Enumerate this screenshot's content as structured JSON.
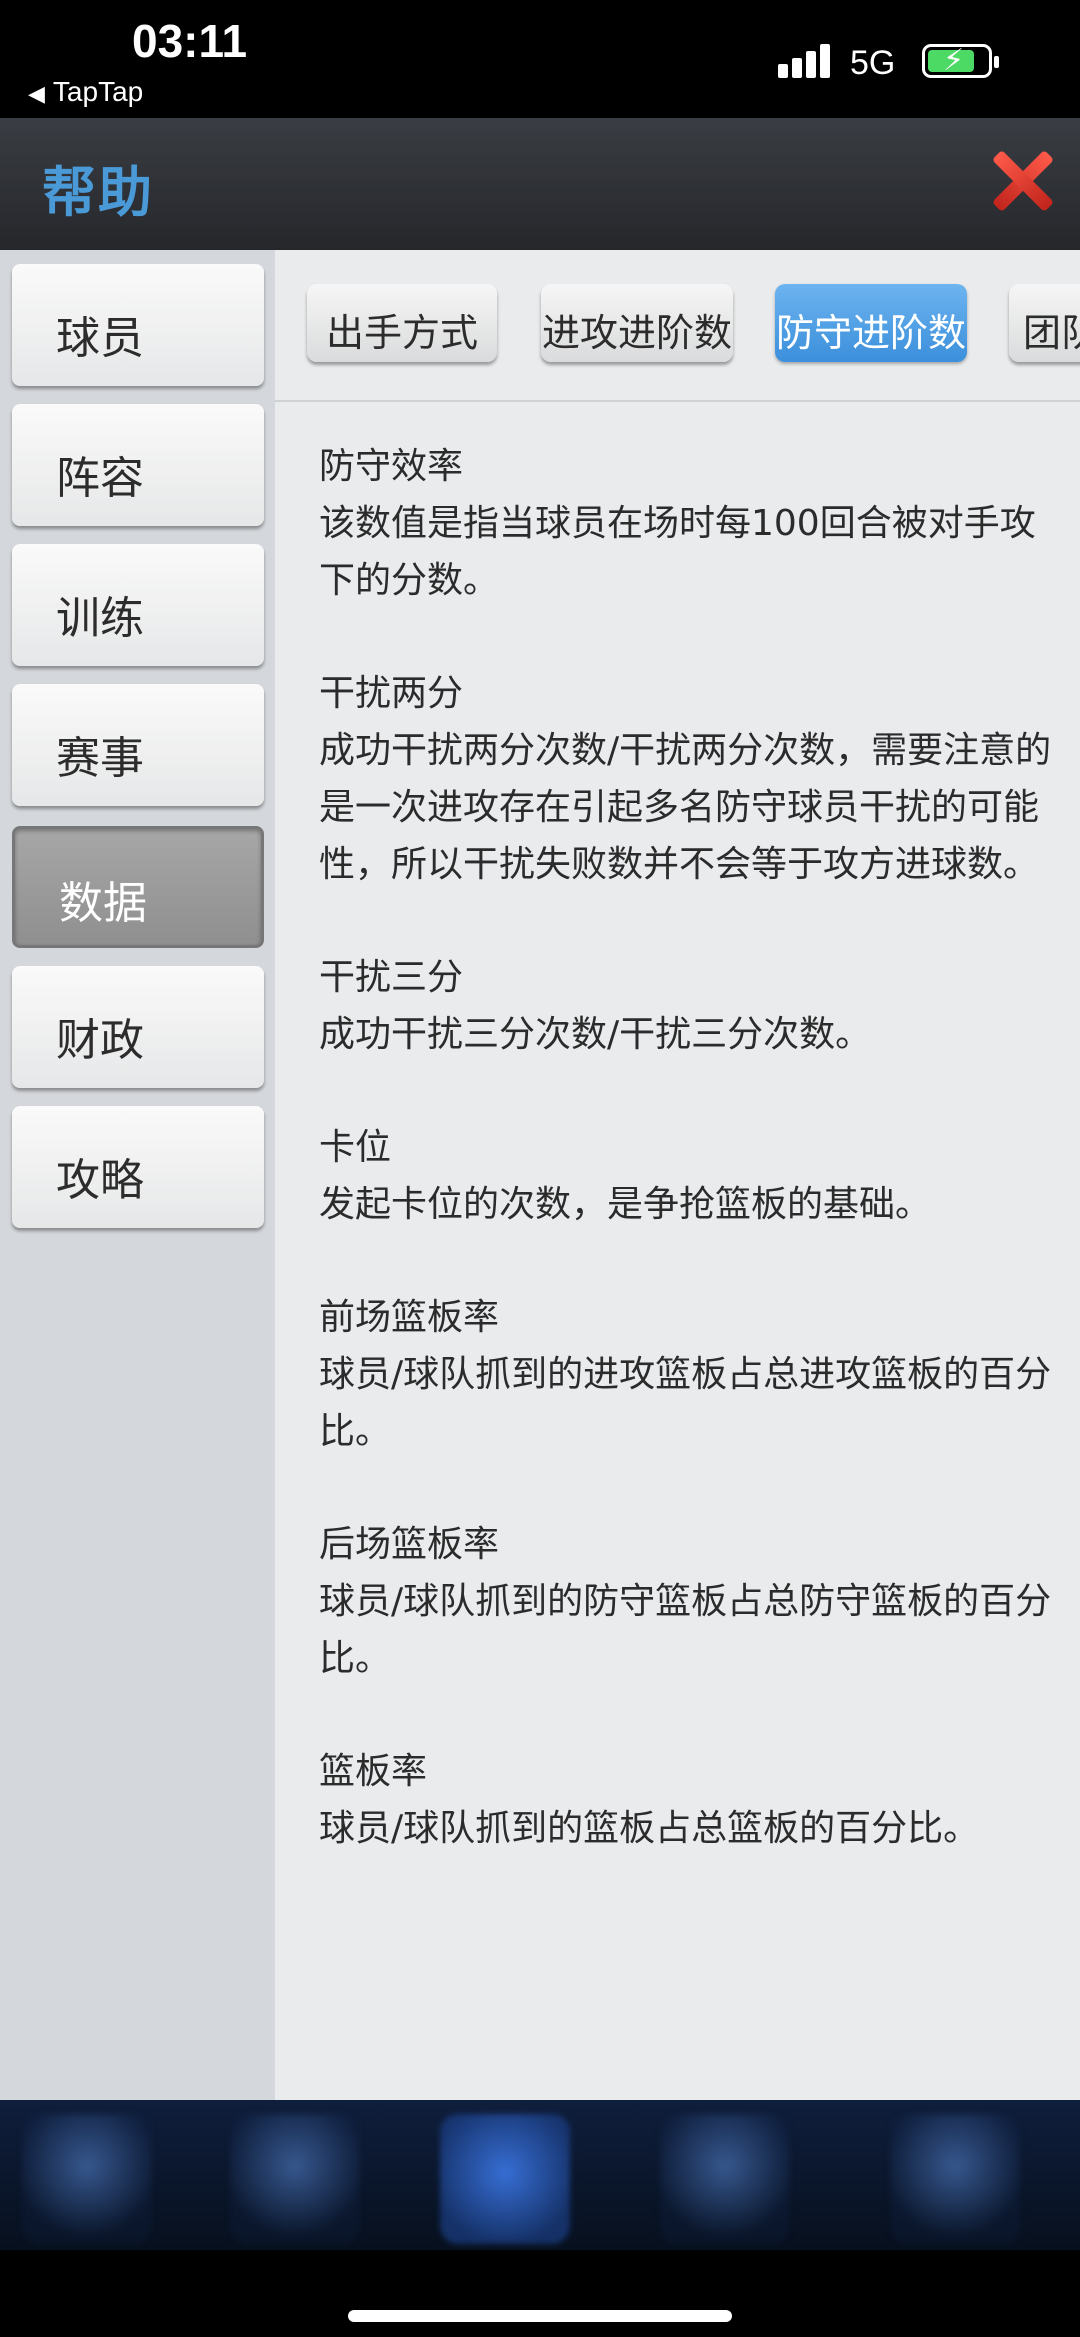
{
  "status_bar": {
    "time": "03:11",
    "back_app": "TapTap",
    "network": "5G"
  },
  "header": {
    "title": "帮助"
  },
  "sidebar": {
    "items": [
      {
        "label": "球员",
        "active": false
      },
      {
        "label": "阵容",
        "active": false
      },
      {
        "label": "训练",
        "active": false
      },
      {
        "label": "赛事",
        "active": false
      },
      {
        "label": "数据",
        "active": true
      },
      {
        "label": "财政",
        "active": false
      },
      {
        "label": "攻略",
        "active": false
      }
    ]
  },
  "tabs": [
    {
      "label": "出手方式",
      "active": false
    },
    {
      "label": "进攻进阶数",
      "active": false
    },
    {
      "label": "防守进阶数",
      "active": true
    },
    {
      "label": "团队",
      "active": false
    }
  ],
  "article": [
    {
      "title": "防守效率",
      "body": "该数值是指当球员在场时每100回合被对手攻下的分数。"
    },
    {
      "title": "干扰两分",
      "body": "成功干扰两分次数/干扰两分次数，需要注意的是一次进攻存在引起多名防守球员干扰的可能性，所以干扰失败数并不会等于攻方进球数。"
    },
    {
      "title": "干扰三分",
      "body": "成功干扰三分次数/干扰三分次数。"
    },
    {
      "title": "卡位",
      "body": "发起卡位的次数，是争抢篮板的基础。"
    },
    {
      "title": "前场篮板率",
      "body": "球员/球队抓到的进攻篮板占总进攻篮板的百分比。"
    },
    {
      "title": "后场篮板率",
      "body": "球员/球队抓到的防守篮板占总防守篮板的百分比。"
    },
    {
      "title": "篮板率",
      "body": "球员/球队抓到的篮板占总篮板的百分比。"
    }
  ],
  "colors": {
    "accent_blue": "#4a9ad8",
    "active_tab": "#3b8fdb",
    "close_red": "#e0362a",
    "battery_green": "#4cd964"
  }
}
